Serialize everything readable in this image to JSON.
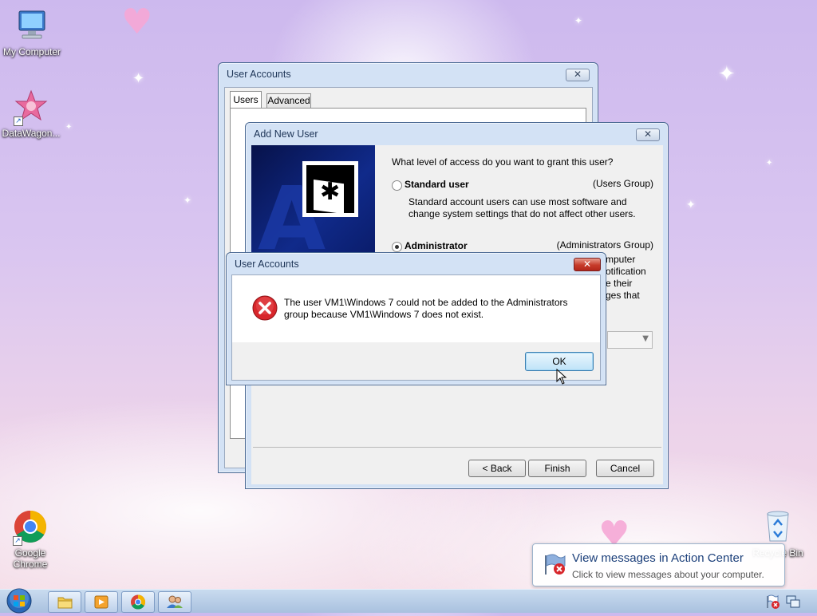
{
  "desktop": {
    "icons": [
      {
        "name": "my-computer",
        "label": "My Computer"
      },
      {
        "name": "datawagon",
        "label": "DataWagon..."
      },
      {
        "name": "google-chrome",
        "label": "Google\nChrome"
      },
      {
        "name": "recycle-bin",
        "label": "Recycle Bin"
      }
    ]
  },
  "user_accounts_window": {
    "title": "User Accounts",
    "close_symbol": "✕",
    "tabs": [
      {
        "label": "Users",
        "active": true
      },
      {
        "label": "Advanced",
        "active": false
      }
    ]
  },
  "add_user_wizard": {
    "title": "Add New User",
    "close_symbol": "✕",
    "question": "What level of access do you want to grant this user?",
    "standard": {
      "label": "Standard user",
      "group": "(Users Group)",
      "description": "Standard account users can use most software and change system settings that do not affect other users.",
      "selected": false
    },
    "administrator": {
      "label": "Administrator",
      "group": "(Administrators Group)",
      "selected": true,
      "partial_text_lines": [
        "mputer",
        "otification",
        "e their",
        "ges that"
      ]
    },
    "buttons": {
      "back": "< Back",
      "finish": "Finish",
      "cancel": "Cancel"
    }
  },
  "error_dialog": {
    "title": "User Accounts",
    "close_symbol": "✕",
    "message": "The user VM1\\Windows 7 could not be added to the Administrators group because VM1\\Windows 7 does not exist.",
    "ok_label": "OK"
  },
  "action_center_popup": {
    "title": "View messages in Action Center",
    "subtitle": "Click to view messages about your computer."
  },
  "taskbar": {
    "buttons": [
      "explorer",
      "media-player",
      "chrome",
      "user-accounts"
    ]
  },
  "colors": {
    "error_red": "#d8262b",
    "title_text": "#1e3557",
    "wizard_banner": "#0b1a5e"
  }
}
